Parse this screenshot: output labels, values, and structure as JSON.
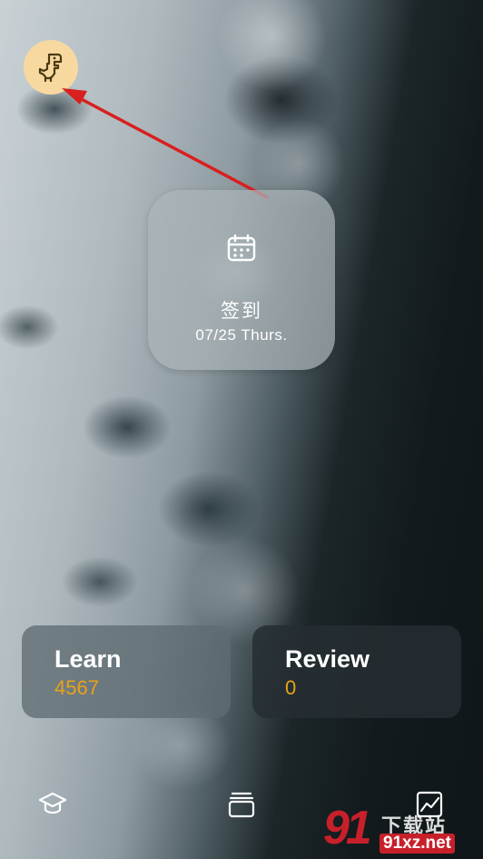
{
  "checkin": {
    "icon": "calendar-icon",
    "title": "签到",
    "date": "07/25 Thurs."
  },
  "stats": {
    "learn": {
      "label": "Learn",
      "value": "4567"
    },
    "review": {
      "label": "Review",
      "value": "0"
    }
  },
  "tabbar": {
    "items": [
      {
        "icon": "graduation-cap-icon"
      },
      {
        "icon": "archive-box-icon"
      },
      {
        "icon": "line-chart-icon"
      }
    ]
  },
  "avatar": {
    "icon": "dinosaur-icon"
  },
  "annotation": {
    "type": "red-arrow",
    "points_to": "avatar"
  },
  "watermark": {
    "logo": "91",
    "sub": "下载站",
    "url": "91xz.net"
  },
  "colors": {
    "accent_number": "#e8a21a",
    "avatar_bg": "#f7d9a0",
    "annotation": "#d8201f",
    "watermark_red": "#c8202a"
  }
}
